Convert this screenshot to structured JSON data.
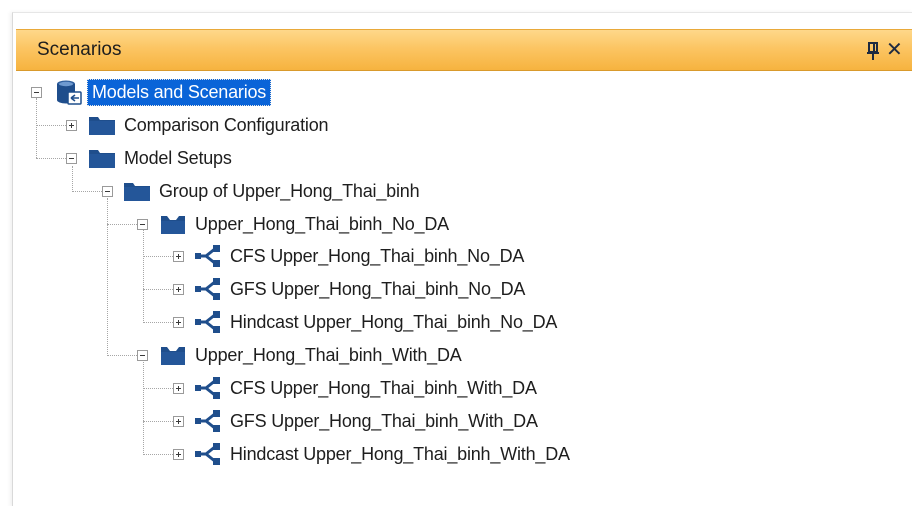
{
  "panel": {
    "title": "Scenarios",
    "pin_icon": "pin-icon",
    "close_icon": "close-icon",
    "close_glyph": "✕"
  },
  "tree": {
    "root": {
      "label": "Models and Scenarios",
      "icon": "database-scenario-icon",
      "expanded": true,
      "selected": true
    },
    "comparison": {
      "label": "Comparison Configuration",
      "icon": "folder-icon",
      "expanded": false
    },
    "model_setups": {
      "label": "Model Setups",
      "icon": "folder-icon",
      "expanded": true
    },
    "group": {
      "label": "Group of Upper_Hong_Thai_binh",
      "icon": "folder-icon",
      "expanded": true
    },
    "no_da": {
      "label": "Upper_Hong_Thai_binh_No_DA",
      "icon": "model-icon",
      "expanded": true,
      "children": [
        {
          "label": "CFS Upper_Hong_Thai_binh_No_DA",
          "icon": "scenario-icon"
        },
        {
          "label": "GFS Upper_Hong_Thai_binh_No_DA",
          "icon": "scenario-icon"
        },
        {
          "label": "Hindcast Upper_Hong_Thai_binh_No_DA",
          "icon": "scenario-icon"
        }
      ]
    },
    "with_da": {
      "label": "Upper_Hong_Thai_binh_With_DA",
      "icon": "model-icon",
      "expanded": true,
      "children": [
        {
          "label": "CFS Upper_Hong_Thai_binh_With_DA",
          "icon": "scenario-icon"
        },
        {
          "label": "GFS Upper_Hong_Thai_binh_With_DA",
          "icon": "scenario-icon"
        },
        {
          "label": "Hindcast Upper_Hong_Thai_binh_With_DA",
          "icon": "scenario-icon"
        }
      ]
    }
  },
  "colors": {
    "titlebar": "#fcc563",
    "selection": "#0a64d8",
    "icon_blue": "#1f4e8c"
  }
}
